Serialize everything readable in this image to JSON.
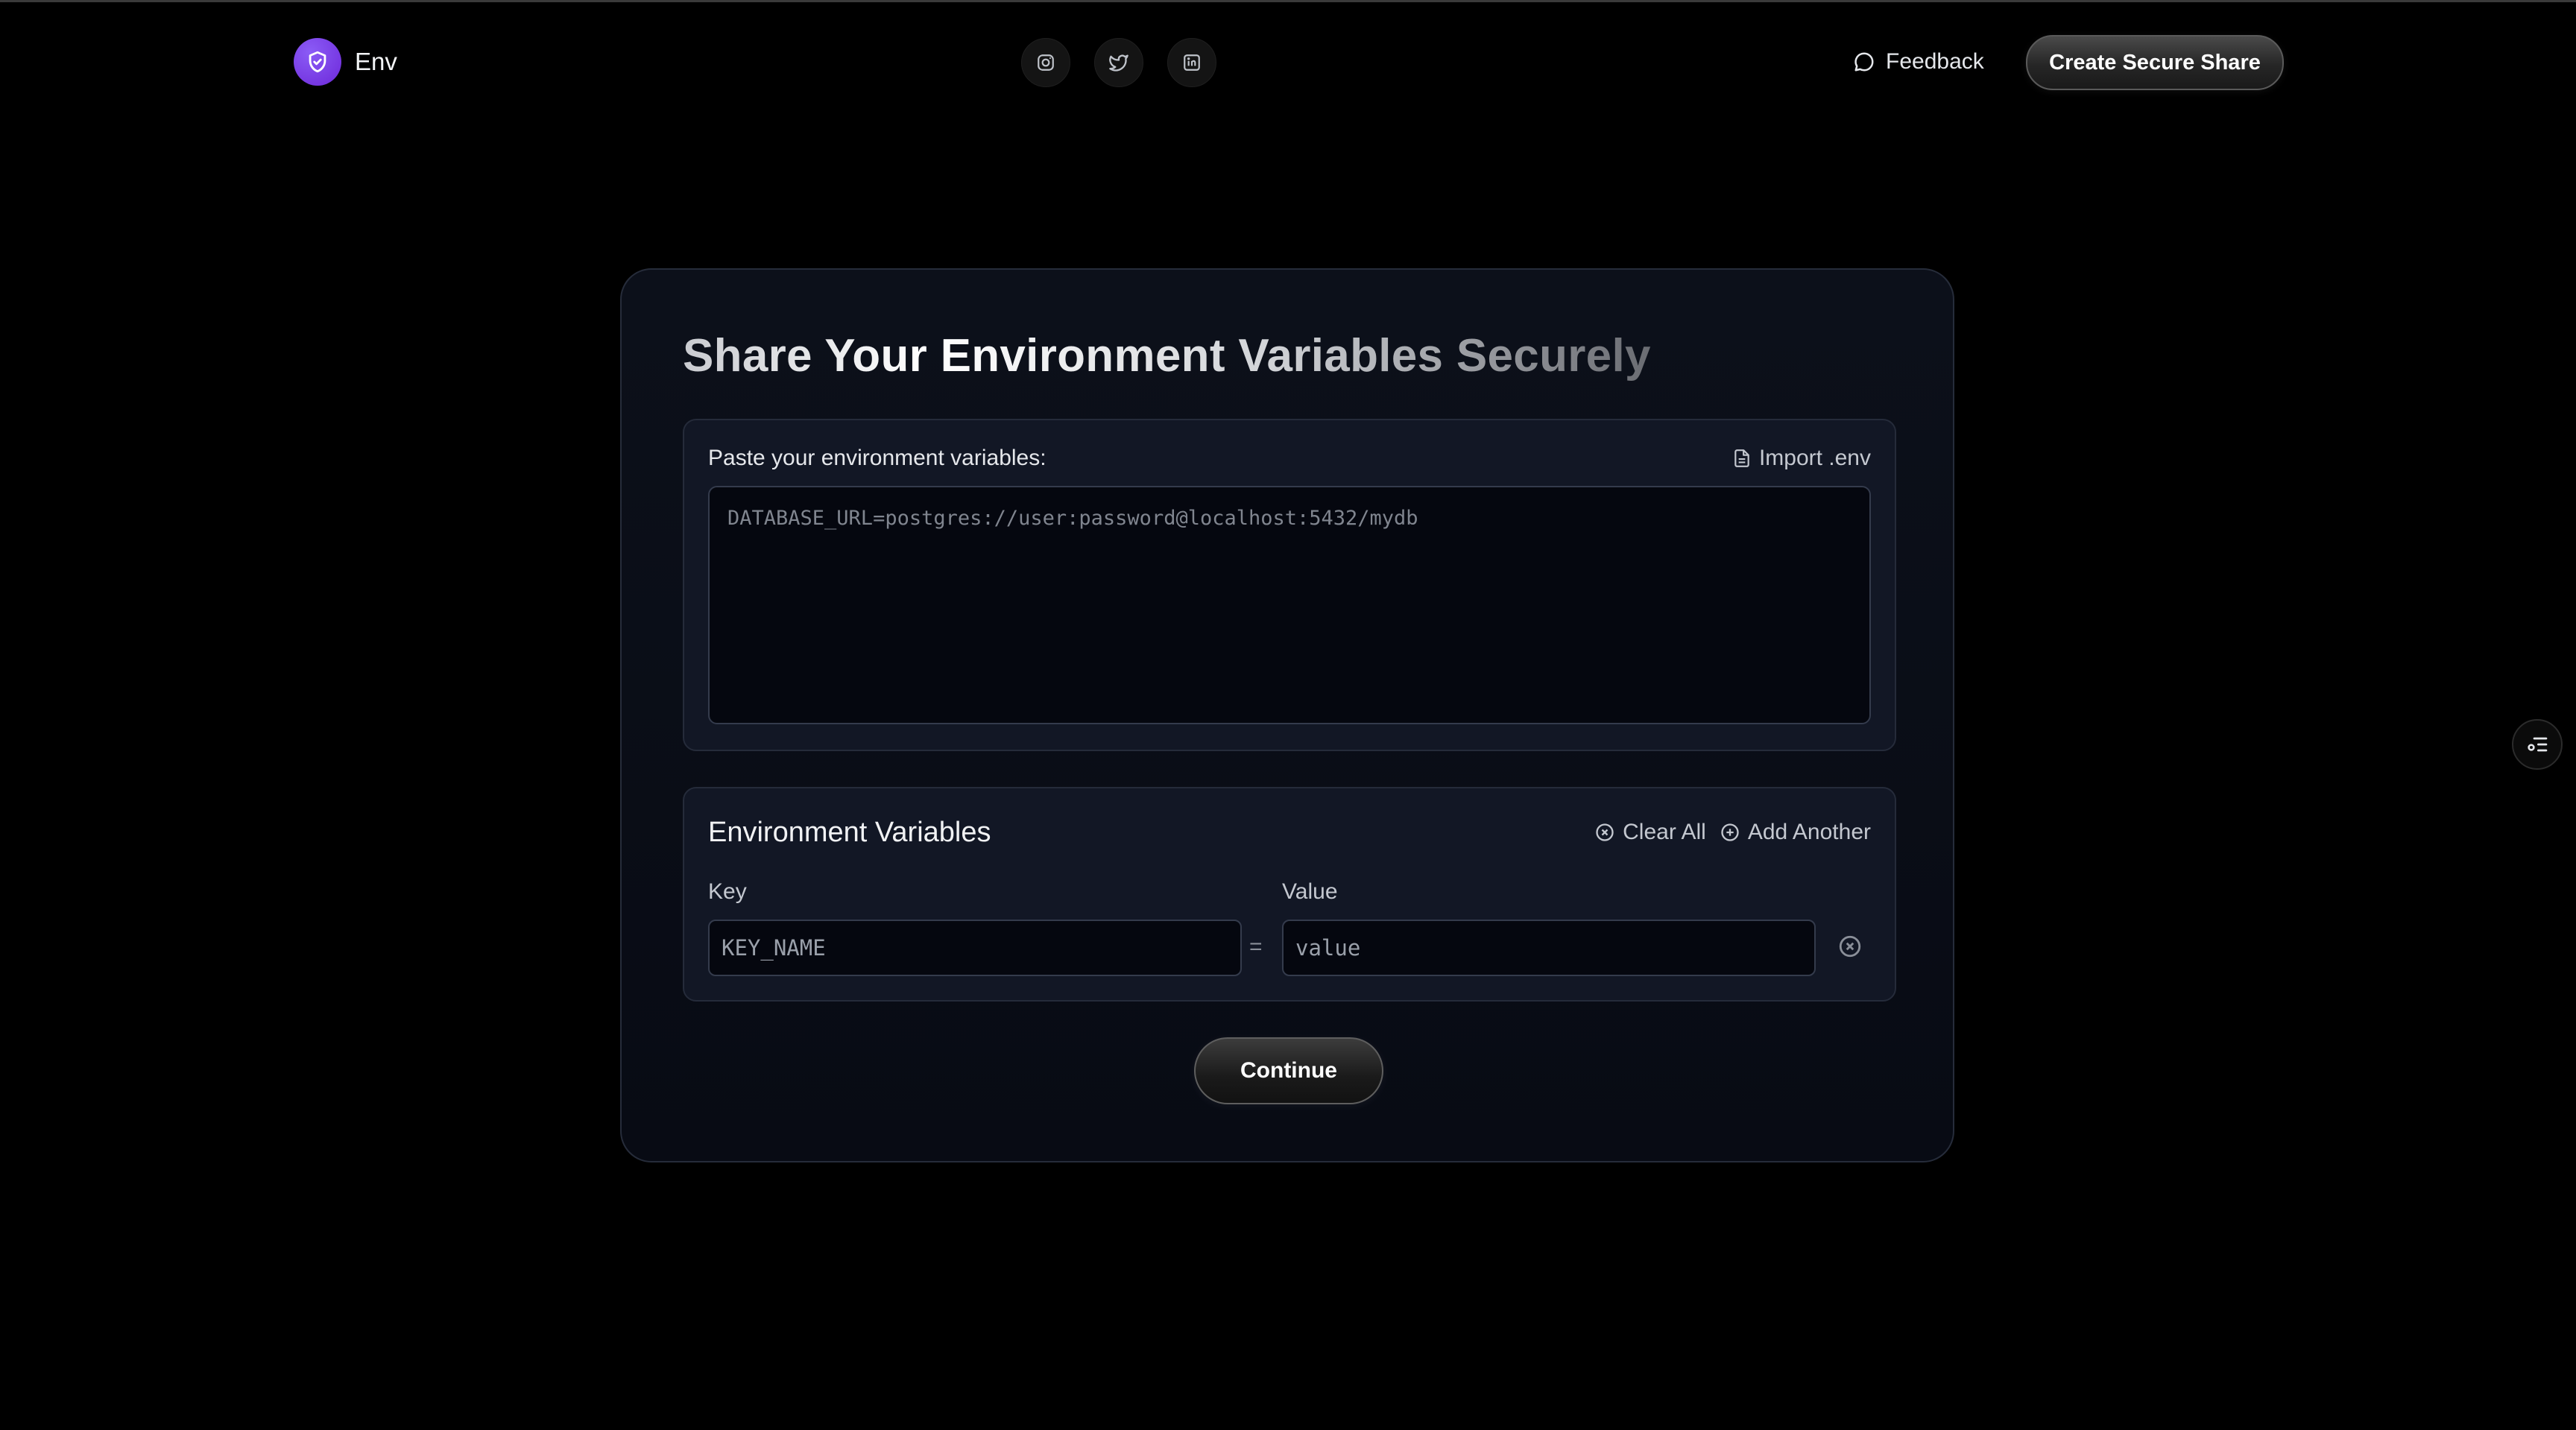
{
  "header": {
    "brand_name": "Env",
    "socials": [
      "instagram-icon",
      "twitter-icon",
      "linkedin-icon"
    ],
    "feedback_label": "Feedback",
    "cta_label": "Create Secure Share"
  },
  "main": {
    "title": "Share Your Environment Variables Securely",
    "paste": {
      "label": "Paste your environment variables:",
      "import_label": "Import .env",
      "placeholder": "DATABASE_URL=postgres://user:password@localhost:5432/mydb"
    },
    "variables": {
      "title": "Environment Variables",
      "clear_label": "Clear All",
      "add_label": "Add Another",
      "key_label": "Key",
      "value_label": "Value",
      "key_placeholder": "KEY_NAME",
      "value_placeholder": "value",
      "separator": "="
    },
    "continue_label": "Continue"
  },
  "colors": {
    "accent": "#7c3aed",
    "background": "#000000",
    "card": "#0a0d16"
  }
}
